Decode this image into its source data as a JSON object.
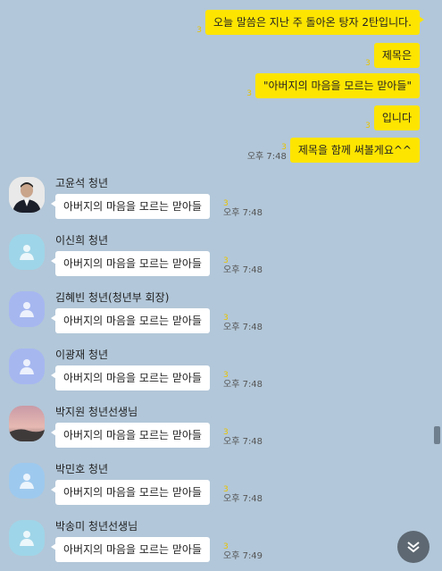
{
  "my_messages": [
    {
      "text": "오늘 말씀은 지난 주 돌아온 탕자 2탄입니다.",
      "unread": "3",
      "time": ""
    },
    {
      "text": "제목은",
      "unread": "3",
      "time": ""
    },
    {
      "text": "\"아버지의 마음을 모르는 맏아들\"",
      "unread": "3",
      "time": ""
    },
    {
      "text": "입니다",
      "unread": "3",
      "time": ""
    },
    {
      "text": "제목을 함께 써볼게요^^",
      "unread": "3",
      "time": "오후 7:48"
    }
  ],
  "incoming": [
    {
      "name": "고윤석 청년",
      "text": "아버지의 마음을 모르는 맏아들",
      "unread": "3",
      "time": "오후 7:48",
      "avatar": "photo-man"
    },
    {
      "name": "이신희 청년",
      "text": "아버지의 마음을 모르는 맏아들",
      "unread": "3",
      "time": "오후 7:48",
      "avatar": "default-teal"
    },
    {
      "name": "김혜빈 청년(청년부 회장)",
      "text": "아버지의 마음을 모르는 맏아들",
      "unread": "3",
      "time": "오후 7:48",
      "avatar": "default-purple"
    },
    {
      "name": "이광재 청년",
      "text": "아버지의 마음을 모르는 맏아들",
      "unread": "3",
      "time": "오후 7:48",
      "avatar": "default-purple"
    },
    {
      "name": "박지원 청년선생님",
      "text": "아버지의 마음을 모르는 맏아들",
      "unread": "3",
      "time": "오후 7:48",
      "avatar": "photo-sunset"
    },
    {
      "name": "박민호 청년",
      "text": "아버지의 마음을 모르는 맏아들",
      "unread": "3",
      "time": "오후 7:48",
      "avatar": "default-blue"
    },
    {
      "name": "박송미 청년선생님",
      "text": "아버지의 마음을 모르는 맏아들",
      "unread": "3",
      "time": "오후 7:49",
      "avatar": "default-teal"
    }
  ],
  "colors": {
    "background": "#b2c7d9",
    "my_bubble": "#fee500",
    "their_bubble": "#ffffff",
    "unread": "#e8c400"
  },
  "icons": {
    "scroll_down": "chevron-down-icon",
    "default_avatar": "person-icon"
  }
}
